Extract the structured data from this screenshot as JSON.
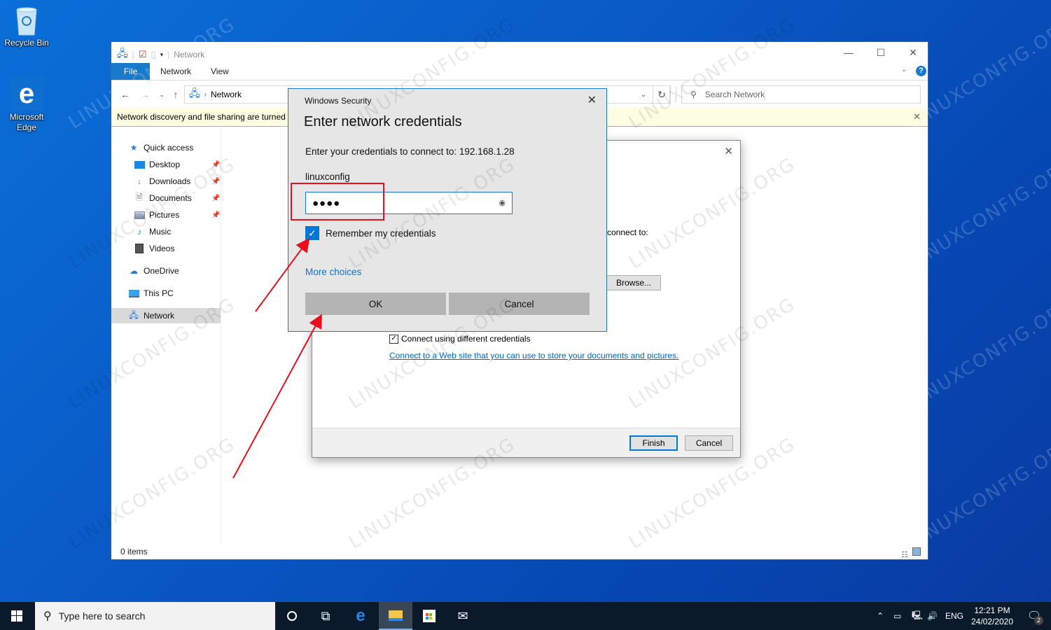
{
  "desktop": {
    "icons": [
      {
        "label": "Recycle Bin",
        "icon": "recycle-bin-icon"
      },
      {
        "label": "Microsoft Edge",
        "icon": "edge-icon"
      }
    ],
    "watermark": "LINUXCONFIG.ORG"
  },
  "explorer": {
    "title": "Network",
    "ribbon_tabs": [
      "File",
      "Network",
      "View"
    ],
    "address_path": "Network",
    "search_placeholder": "Search Network",
    "infobar_text": "Network discovery and file sharing are turned off",
    "sidebar": [
      {
        "label": "Quick access",
        "icon": "star-icon",
        "pinned": false
      },
      {
        "label": "Desktop",
        "icon": "desktop-folder-icon",
        "pinned": true
      },
      {
        "label": "Downloads",
        "icon": "download-arrow-icon",
        "pinned": true
      },
      {
        "label": "Documents",
        "icon": "documents-icon",
        "pinned": true
      },
      {
        "label": "Pictures",
        "icon": "pictures-icon",
        "pinned": true
      },
      {
        "label": "Music",
        "icon": "music-note-icon",
        "pinned": false
      },
      {
        "label": "Videos",
        "icon": "videos-icon",
        "pinned": false
      },
      {
        "label": "OneDrive",
        "icon": "cloud-icon",
        "pinned": false
      },
      {
        "label": "This PC",
        "icon": "computer-icon",
        "pinned": false
      },
      {
        "label": "Network",
        "icon": "network-icon",
        "pinned": false,
        "selected": true
      }
    ],
    "status": "0 items"
  },
  "map_dialog": {
    "connect_to_fragment": "connect to:",
    "browse_label": "Browse...",
    "different_credentials_label": "Connect using different credentials",
    "different_credentials_checked": true,
    "website_link": "Connect to a Web site that you can use to store your documents and pictures.",
    "finish_label": "Finish",
    "cancel_label": "Cancel"
  },
  "security_dialog": {
    "window_title": "Windows Security",
    "heading": "Enter network credentials",
    "prompt": "Enter your credentials to connect to: 192.168.1.28",
    "username": "linuxconfig",
    "password_masked": "●●●●",
    "remember_label": "Remember my credentials",
    "remember_checked": true,
    "more_choices": "More choices",
    "ok_label": "OK",
    "cancel_label": "Cancel",
    "accent_color": "#0078d7",
    "annotation_color": "#e8101e"
  },
  "taskbar": {
    "search_placeholder": "Type here to search",
    "pinned": [
      "cortana-icon",
      "task-view-icon",
      "edge-icon",
      "file-explorer-icon",
      "store-icon",
      "mail-icon"
    ],
    "language": "ENG",
    "time": "12:21 PM",
    "date": "24/02/2020",
    "notification_count": "2"
  }
}
